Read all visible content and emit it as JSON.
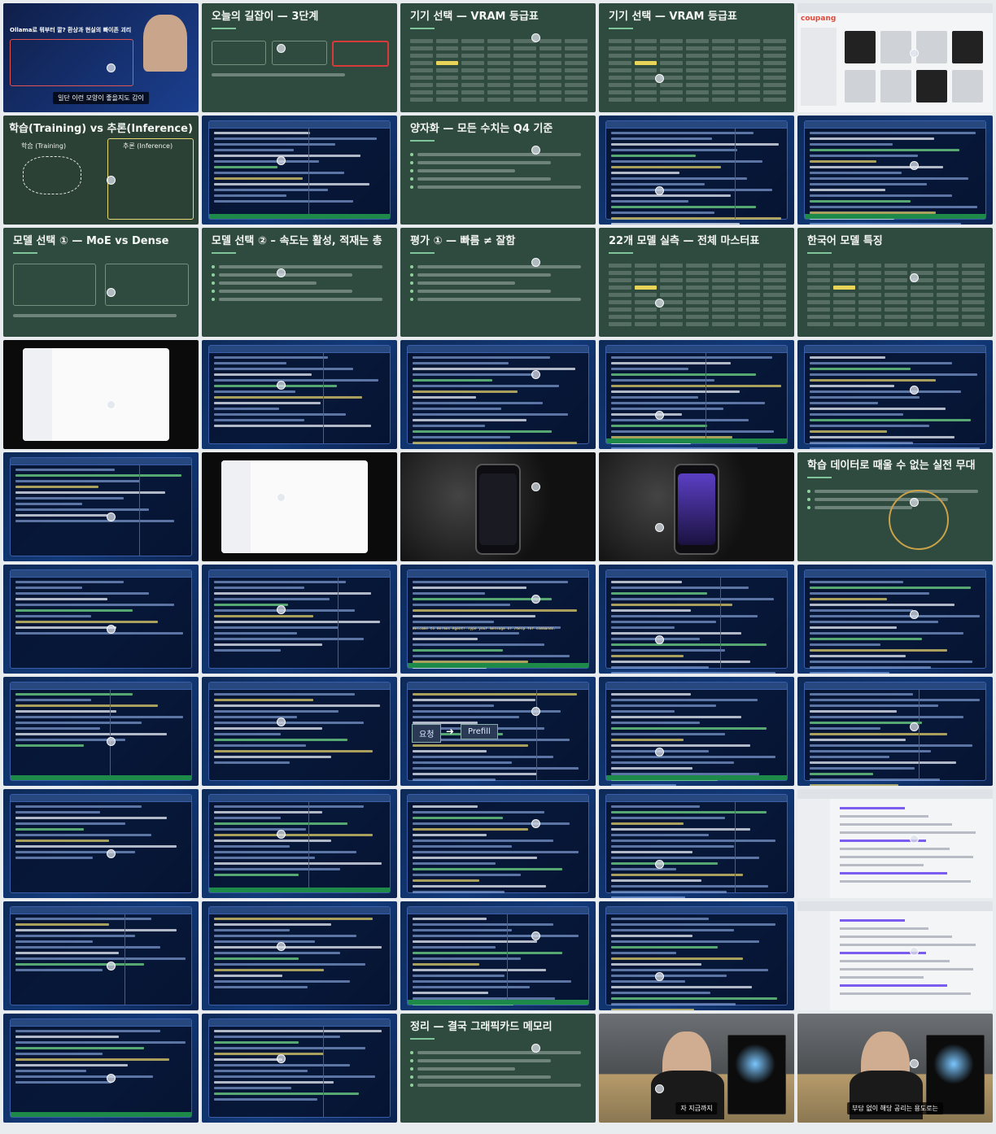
{
  "tiles": [
    {
      "type": "video",
      "overlay_text": "Ollama로 뭐부터 깔? 환상과 현실의 빠이존 괴리",
      "caption": "일단 이런 모양이 좋을지도 감이"
    },
    {
      "type": "slide",
      "title": "오늘의 길잡이 — 3단계"
    },
    {
      "type": "slide",
      "title": "기기 선택 — VRAM 등급표"
    },
    {
      "type": "slide",
      "title": "기기 선택 — VRAM 등급표"
    },
    {
      "type": "browser",
      "brand": "coupang"
    },
    {
      "type": "chalk",
      "title": "학습(Training) vs 추론(Inference)",
      "left": "학습 (Training)",
      "right": "추론 (Inference)"
    },
    {
      "type": "terminal"
    },
    {
      "type": "slide",
      "title": "양자화 — 모든 수치는 Q4 기준"
    },
    {
      "type": "terminal"
    },
    {
      "type": "terminal"
    },
    {
      "type": "slide",
      "title": "모델 선택 ① — MoE vs Dense"
    },
    {
      "type": "slide",
      "title": "모델 선택 ② – 속도는 활성, 적재는 총"
    },
    {
      "type": "slide",
      "title": "평가 ① — 빠름 ≠ 잘함"
    },
    {
      "type": "slide",
      "title": "22개 모델 실측 — 전체 마스터표"
    },
    {
      "type": "slide",
      "title": "한국어 모델 특징"
    },
    {
      "type": "app"
    },
    {
      "type": "terminal"
    },
    {
      "type": "terminal"
    },
    {
      "type": "terminal"
    },
    {
      "type": "terminal"
    },
    {
      "type": "terminal"
    },
    {
      "type": "app"
    },
    {
      "type": "phone"
    },
    {
      "type": "phone"
    },
    {
      "type": "slide",
      "title": "학습 데이터로 때울 수 없는 실전 무대"
    },
    {
      "type": "terminal"
    },
    {
      "type": "terminal"
    },
    {
      "type": "terminal",
      "prompt": "Welcome to Hermes Agent! Type your message or /help for commands."
    },
    {
      "type": "terminal"
    },
    {
      "type": "terminal"
    },
    {
      "type": "terminal"
    },
    {
      "type": "terminal"
    },
    {
      "type": "terminal",
      "flow_a": "요청",
      "flow_b": "Prefill"
    },
    {
      "type": "terminal"
    },
    {
      "type": "terminal"
    },
    {
      "type": "terminal"
    },
    {
      "type": "terminal"
    },
    {
      "type": "terminal"
    },
    {
      "type": "terminal"
    },
    {
      "type": "browser"
    },
    {
      "type": "terminal"
    },
    {
      "type": "terminal"
    },
    {
      "type": "terminal"
    },
    {
      "type": "terminal"
    },
    {
      "type": "browser"
    },
    {
      "type": "terminal"
    },
    {
      "type": "terminal"
    },
    {
      "type": "slide",
      "title": "정리 — 결국 그래픽카드 메모리"
    },
    {
      "type": "person",
      "caption": "자 지금까지"
    },
    {
      "type": "person",
      "caption": "부담 없이 해당 공리는 용도로는"
    }
  ]
}
